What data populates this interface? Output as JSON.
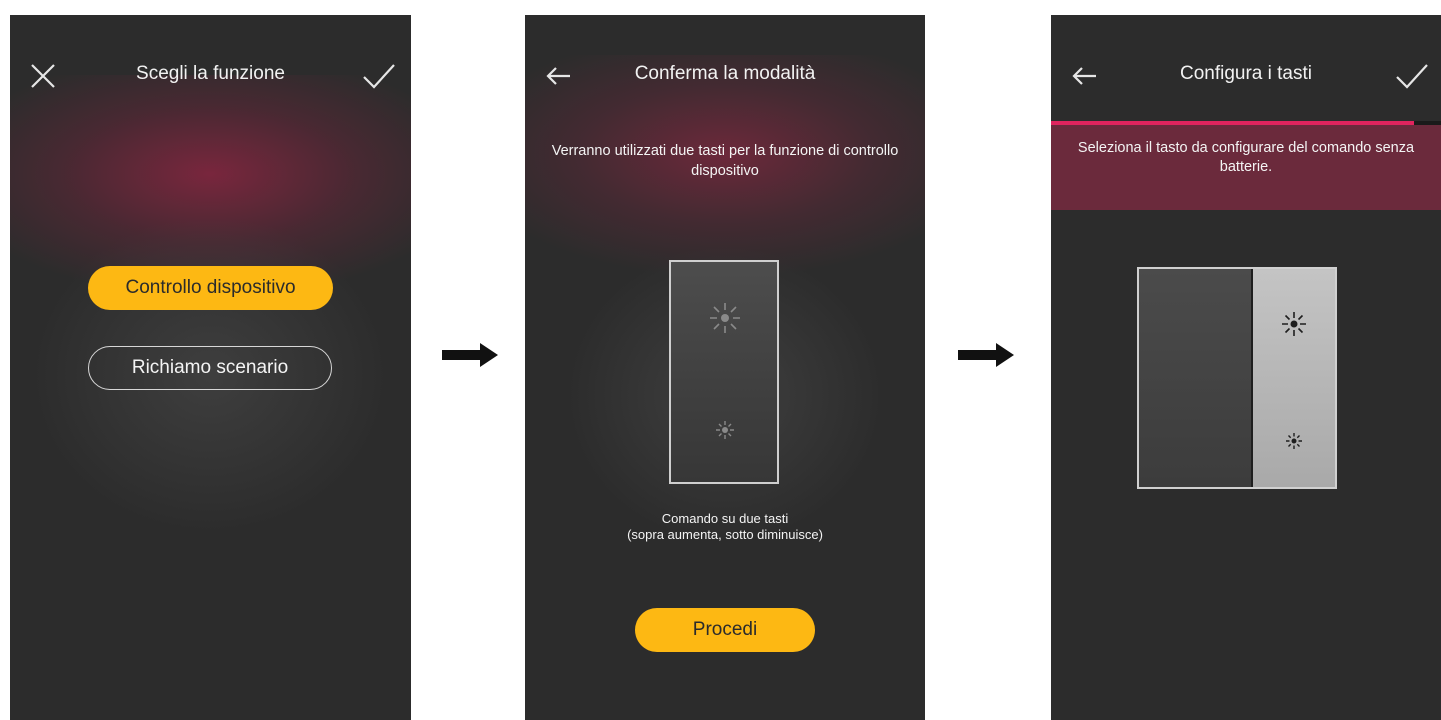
{
  "screen1": {
    "title": "Scegli la funzione",
    "close_icon": "close-icon",
    "confirm_icon": "checkmark-icon",
    "options": [
      {
        "label": "Controllo dispositivo",
        "selected": true
      },
      {
        "label": "Richiamo scenario",
        "selected": false
      }
    ]
  },
  "screen2": {
    "title": "Conferma la modalità",
    "back_icon": "back-arrow-icon",
    "description": "Verranno utilizzati due tasti per la funzione di controllo dispositivo",
    "caption_line1": "Comando su due tasti",
    "caption_line2": "(sopra aumenta, sotto diminuisce)",
    "button_label": "Procedi"
  },
  "screen3": {
    "title": "Configura i tasti",
    "back_icon": "back-arrow-icon",
    "confirm_icon": "checkmark-icon",
    "progress": 0.93,
    "description": "Seleziona il tasto da configurare del comando senza batterie."
  },
  "colors": {
    "screen_bg": "#2c2c2c",
    "accent_yellow": "#fdb813",
    "accent_magenta": "#e0245e",
    "band": "#6b2a3c"
  }
}
